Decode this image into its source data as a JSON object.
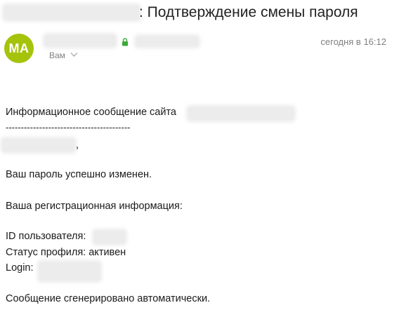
{
  "header": {
    "subject_suffix": ": Подтверждение смены пароля",
    "avatar_initials": "MA",
    "avatar_color": "#a5c30b",
    "recipient_label": "Вам",
    "timestamp": "сегодня в 16:12",
    "secure_icon_color": "#3aaa35"
  },
  "body": {
    "info_line": "Информационное сообщение сайта",
    "separator": "-----------------------------------------",
    "greeting_suffix": ",",
    "password_changed": "Ваш пароль успешно изменен.",
    "reg_info_heading": "Ваша регистрационная информация:",
    "user_id_label": "ID пользователя:",
    "profile_status": "Статус профиля: активен",
    "login_label": "Login:",
    "auto_generated": "Сообщение сгенерировано автоматически."
  }
}
